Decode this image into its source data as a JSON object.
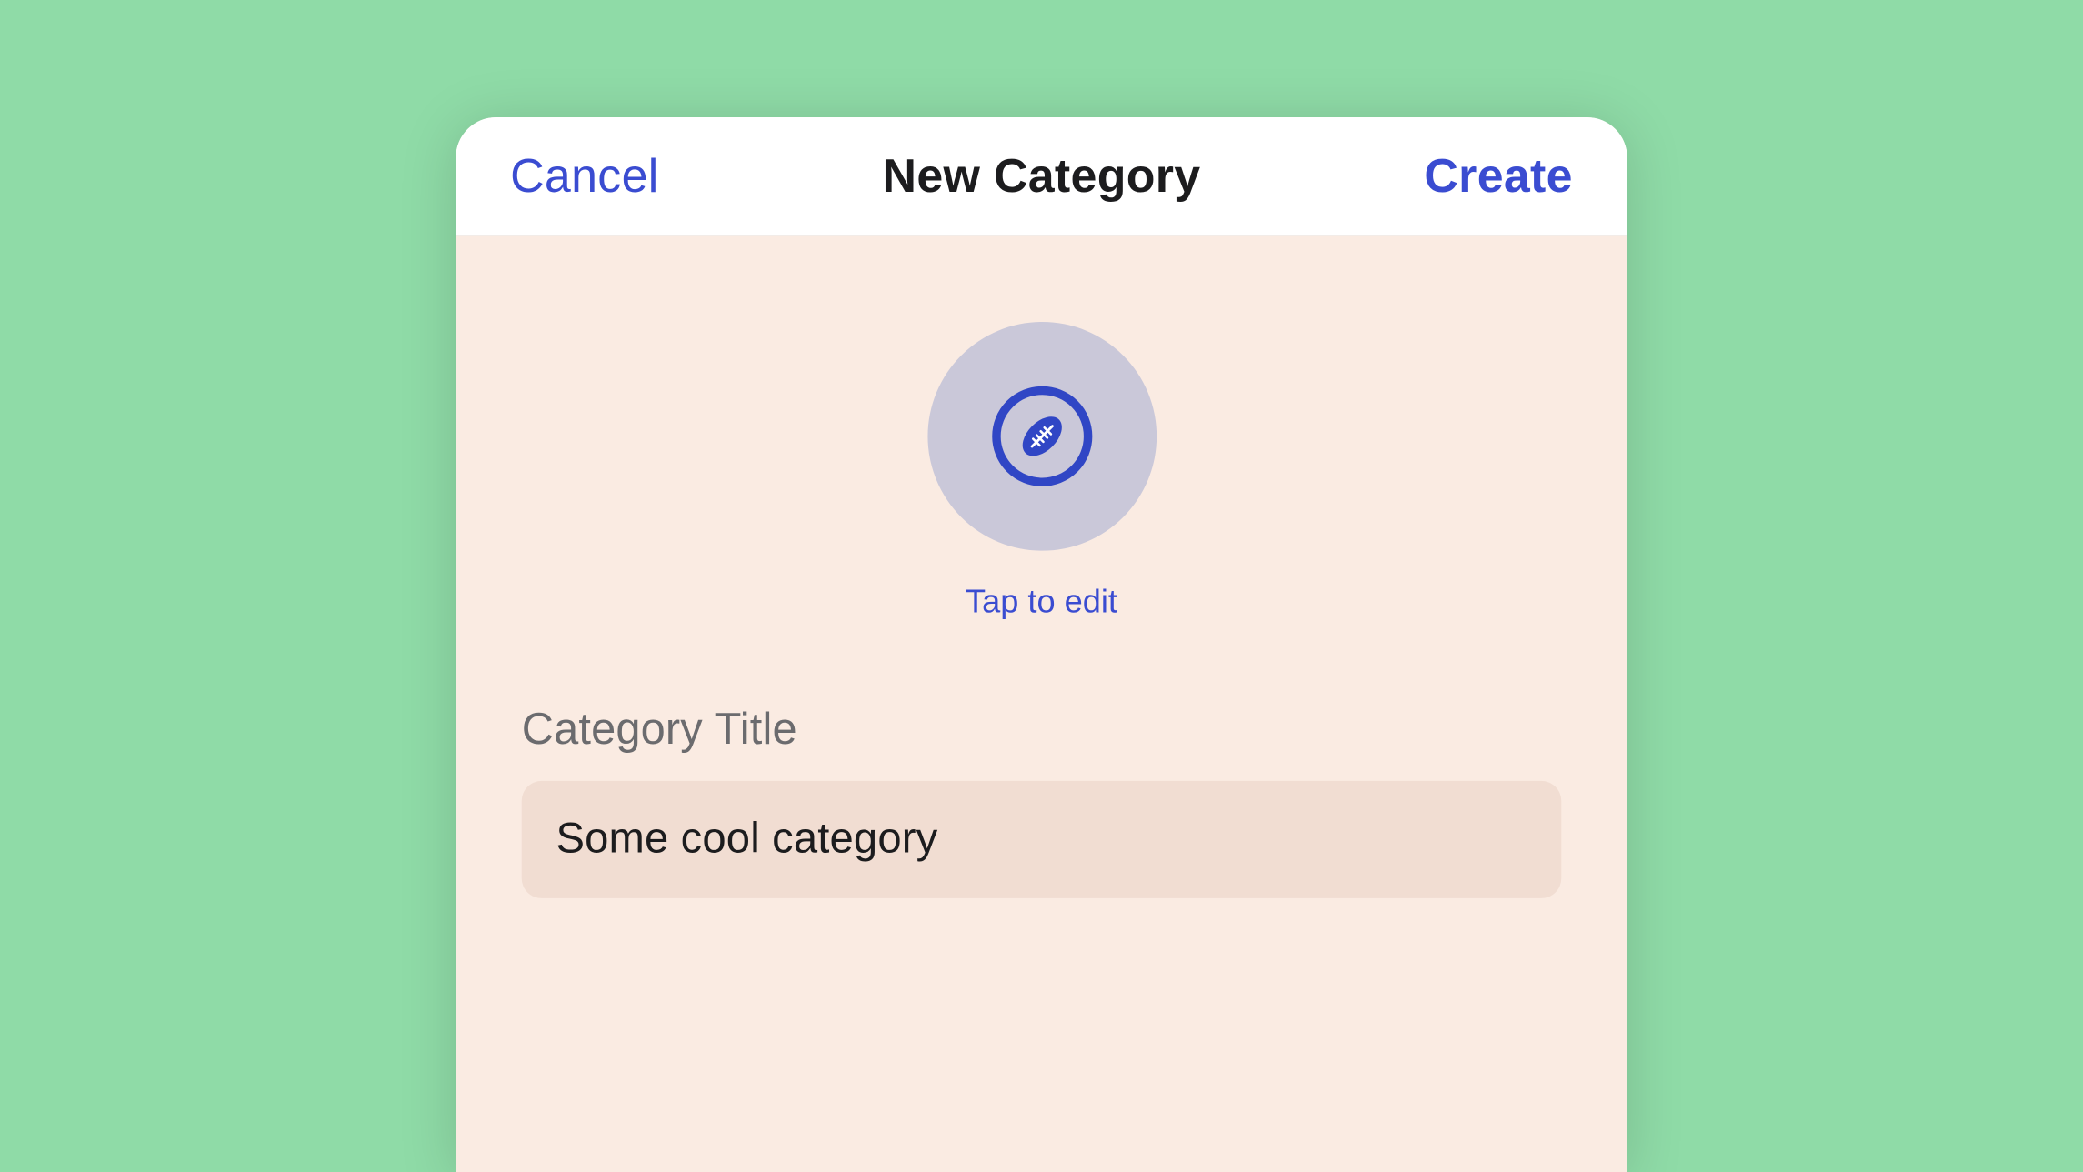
{
  "nav": {
    "cancel_label": "Cancel",
    "title": "New Category",
    "create_label": "Create"
  },
  "icon_picker": {
    "icon_name": "football-icon",
    "tap_label": "Tap to edit"
  },
  "category_title": {
    "section_label": "Category Title",
    "value": "Some cool category"
  },
  "colors": {
    "accent": "#3a4cd1",
    "sheet_bg": "#faebe2",
    "input_bg": "#f1ddd2",
    "icon_bg": "#cac8d9",
    "page_bg": "#8fdba7"
  }
}
